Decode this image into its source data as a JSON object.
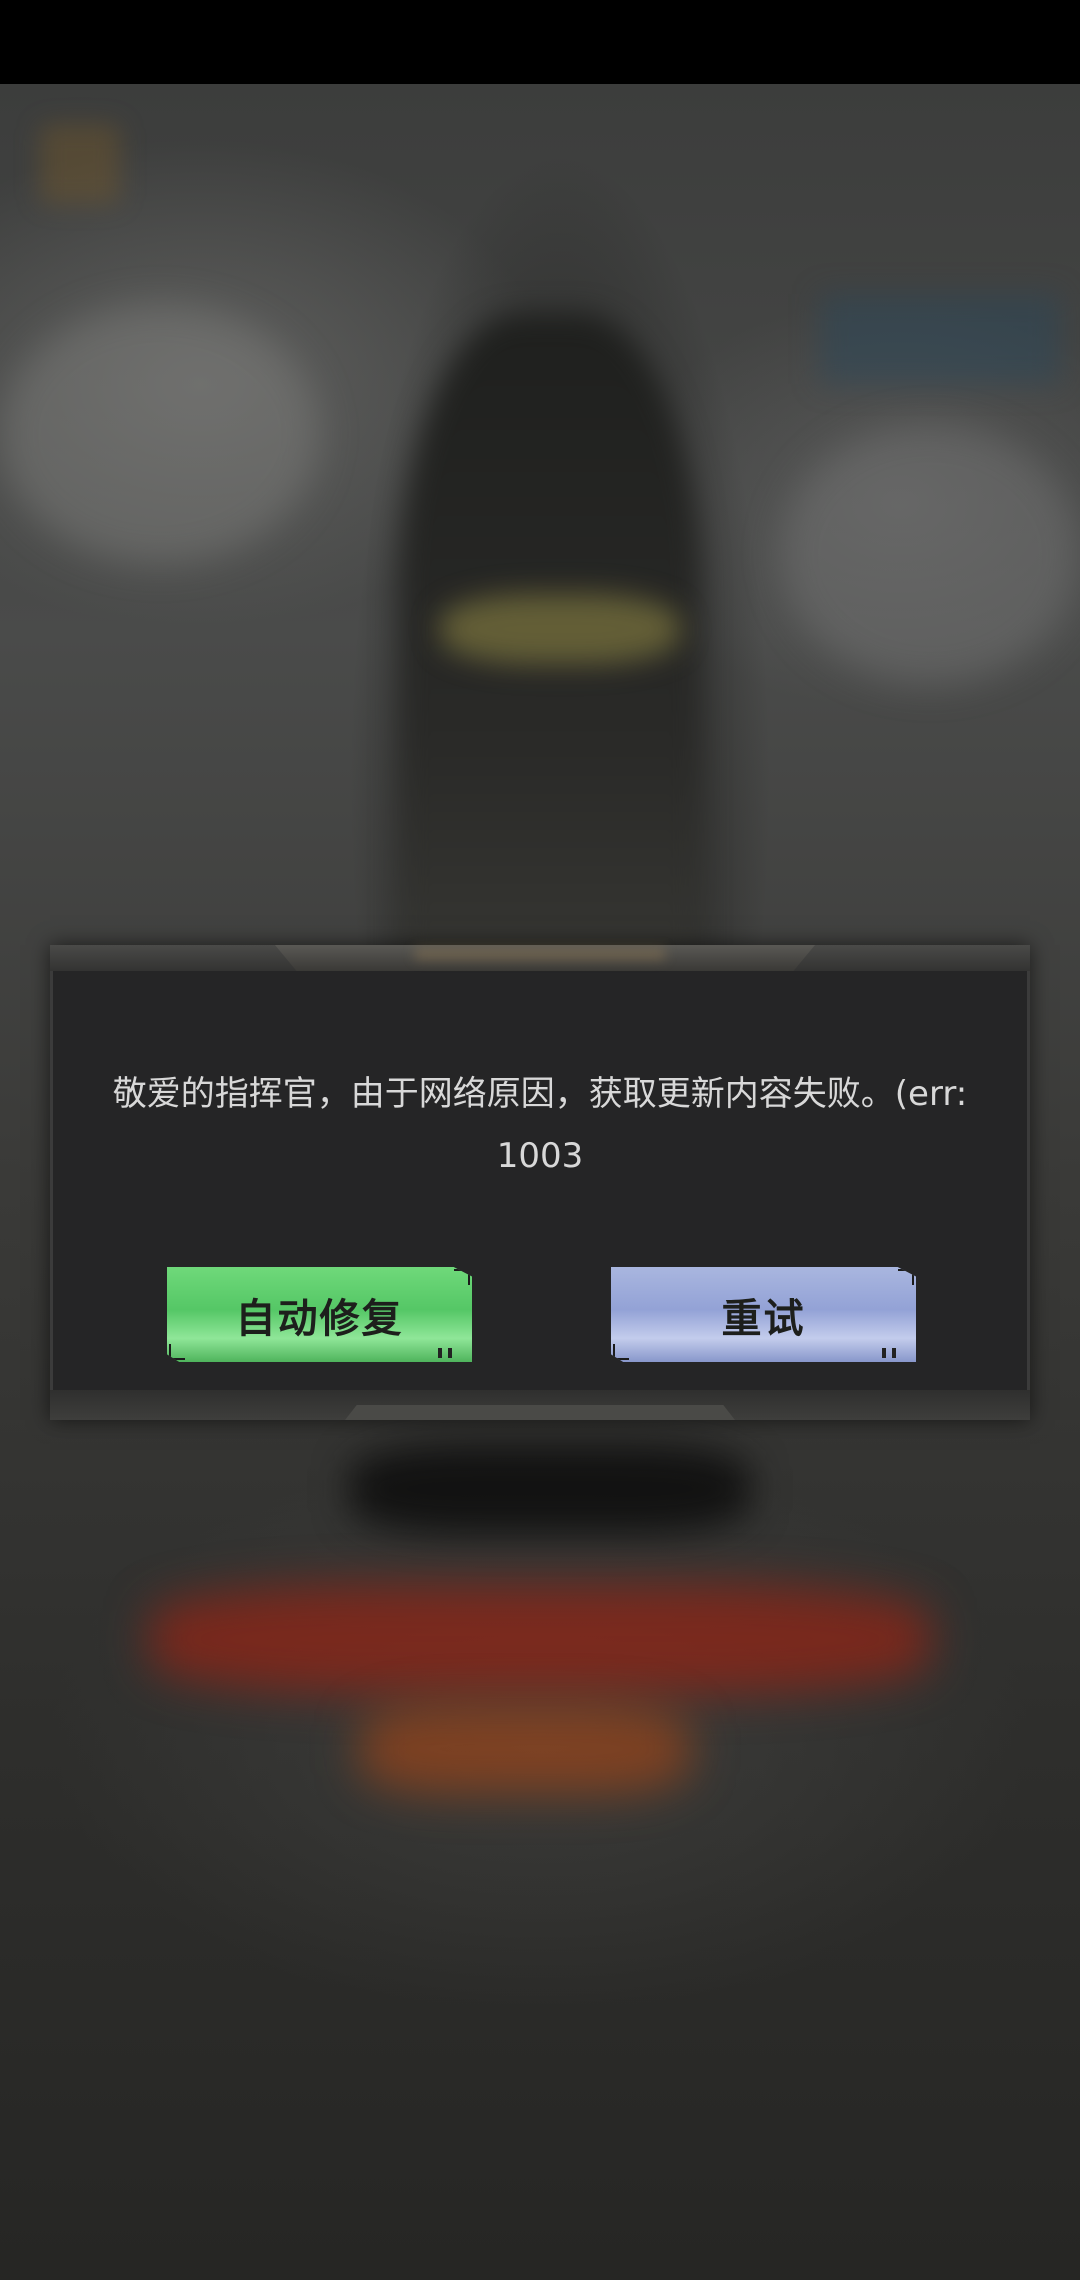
{
  "dialog": {
    "message": "敬爱的指挥官，由于网络原因，获取更新内容失败。(err: 1003",
    "buttons": {
      "repair_label": "自动修复",
      "retry_label": "重试"
    }
  },
  "colors": {
    "repair_button": "#5ccb6c",
    "retry_button": "#9eacdc",
    "dialog_background": "#252526",
    "message_text": "#d8d8d8"
  }
}
